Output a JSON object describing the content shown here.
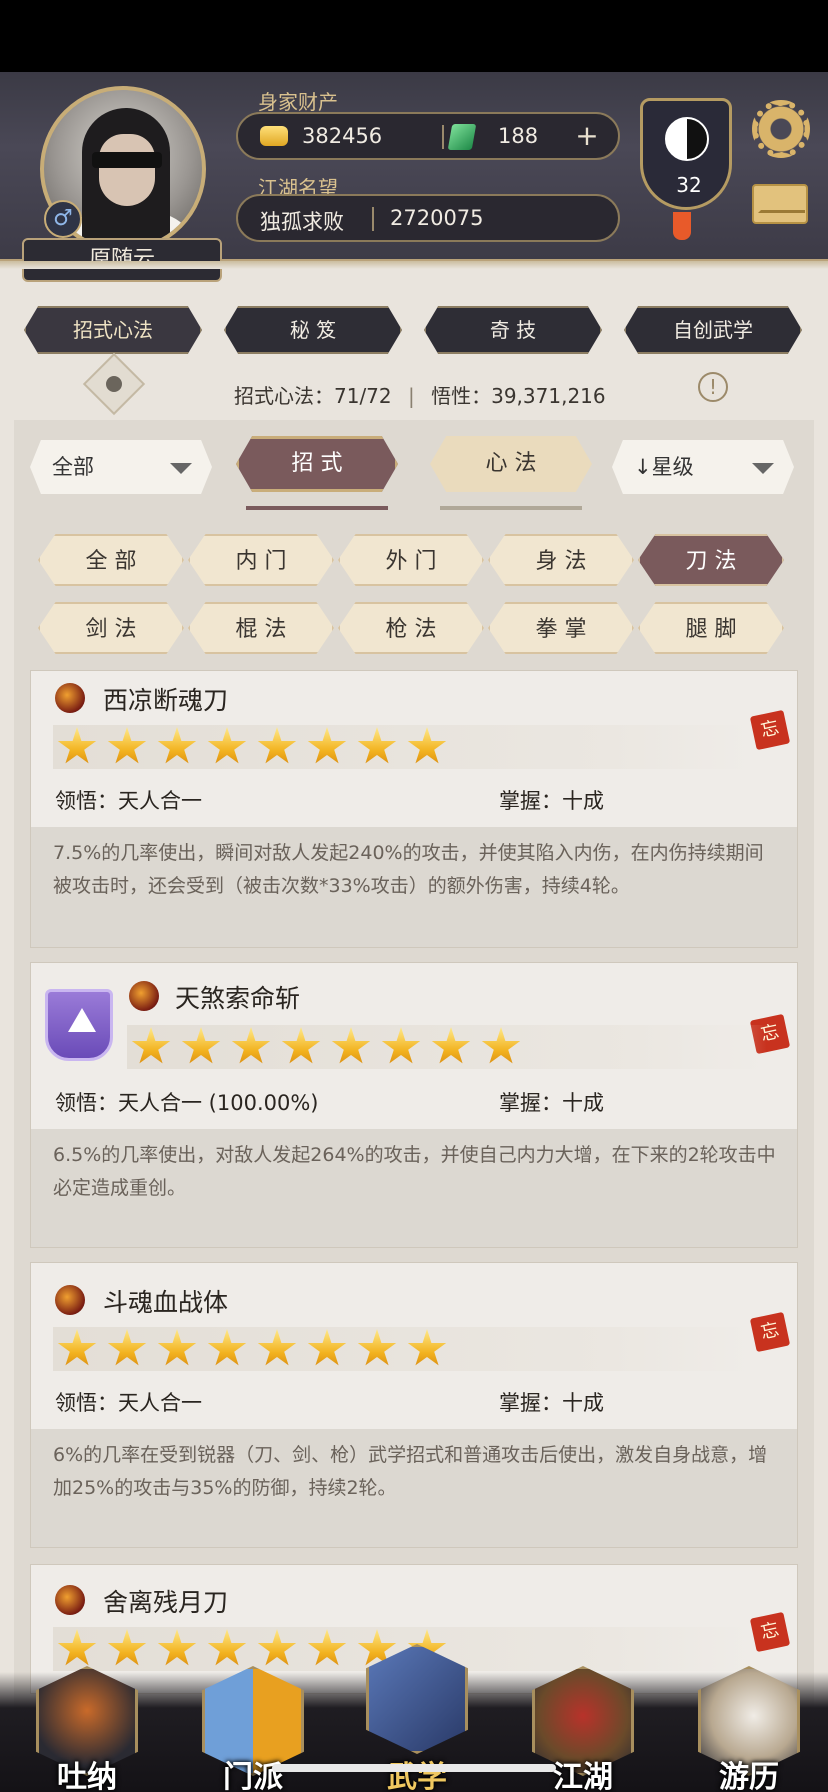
{
  "profile": {
    "name": "原随云",
    "gender_icon": "male-icon",
    "wealth_label": "身家财产",
    "gold": "382456",
    "jade": "188",
    "reputation_label": "江湖名望",
    "reputation_title": "独孤求败",
    "reputation_value": "2720075",
    "level": "32"
  },
  "main_tabs": [
    "招式心法",
    "秘 笈",
    "奇 技",
    "自创武学"
  ],
  "stats": {
    "moves_label": "招式心法：71/72",
    "insight_label": "悟性：39,371,216",
    "separator": "|"
  },
  "filters": {
    "category_dropdown": "全部",
    "seg_tabs": [
      "招 式",
      "心 法"
    ],
    "sort_dropdown": "↓星级"
  },
  "chips_row1": [
    "全 部",
    "内 门",
    "外 门",
    "身 法",
    "刀 法"
  ],
  "chips_row2": [
    "剑 法",
    "棍 法",
    "枪 法",
    "拳 掌",
    "腿 脚"
  ],
  "active_chip": "刀 法",
  "skills": [
    {
      "name": "西凉断魂刀",
      "stars": 8,
      "comprehension": "领悟：天人合一",
      "mastery": "掌握：十成",
      "description": "7.5%的几率使出，瞬间对敌人发起240%的攻击，并使其陷入内伤，在内伤持续期间被攻击时，还会受到（被击次数*33%攻击）的额外伤害，持续4轮。",
      "badge": "忘"
    },
    {
      "name": "天煞索命斩",
      "stars": 8,
      "comprehension": "领悟：天人合一 (100.00%)",
      "mastery": "掌握：十成",
      "description": "6.5%的几率使出，对敌人发起264%的攻击，并使自己内力大增，在下来的2轮攻击中必定造成重创。",
      "badge": "忘"
    },
    {
      "name": "斗魂血战体",
      "stars": 8,
      "comprehension": "领悟：天人合一",
      "mastery": "掌握：十成",
      "description": "6%的几率在受到锐器（刀、剑、枪）武学招式和普通攻击后使出，激发自身战意，增加25%的攻击与35%的防御，持续2轮。",
      "badge": "忘"
    },
    {
      "name": "舍离残月刀",
      "stars": 8,
      "badge": "忘"
    }
  ],
  "bottom_nav": [
    "吐纳",
    "门派",
    "武学",
    "江湖",
    "游历"
  ],
  "active_nav": "武学"
}
